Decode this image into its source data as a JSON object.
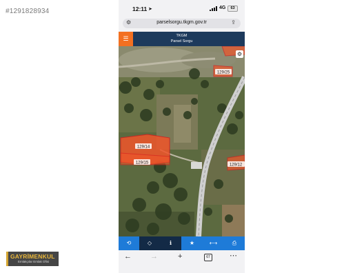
{
  "watermark_id": "#1291828934",
  "logo": {
    "main": "GAYRİMENKUL",
    "sub": "Emlakçılar Emlak Ofisi"
  },
  "status_bar": {
    "time": "12:11",
    "network": "4G",
    "battery": "63"
  },
  "browser": {
    "url": "parselsorgu.tkgm.gov.tr"
  },
  "app": {
    "title": "TKGM",
    "subtitle": "Parsel Sorgu"
  },
  "map": {
    "parcel_labels": [
      "129/14",
      "129/15",
      "129/25",
      "129/12"
    ],
    "colors": {
      "parcel_fill": "#f0552a",
      "parcel_border": "#d81e1e",
      "label_bg": "#ffffff",
      "label_text": "#1a1a1a",
      "road": "#c8c8c8"
    }
  },
  "toolbar": {
    "items": [
      {
        "icon": "refresh-icon",
        "glyph": "⟲"
      },
      {
        "icon": "diamond-icon",
        "glyph": "◇"
      },
      {
        "icon": "info-icon",
        "glyph": "ℹ"
      },
      {
        "icon": "star-icon",
        "glyph": "★"
      },
      {
        "icon": "measure-icon",
        "glyph": "⟷"
      },
      {
        "icon": "print-icon",
        "glyph": "⎙"
      }
    ],
    "colors": {
      "background": "#1e7bd8",
      "active": "#132a46"
    }
  },
  "browser_nav": {
    "tabs_count": "67"
  },
  "colors": {
    "header": "#1d3a5c",
    "menu_button": "#f37021"
  }
}
